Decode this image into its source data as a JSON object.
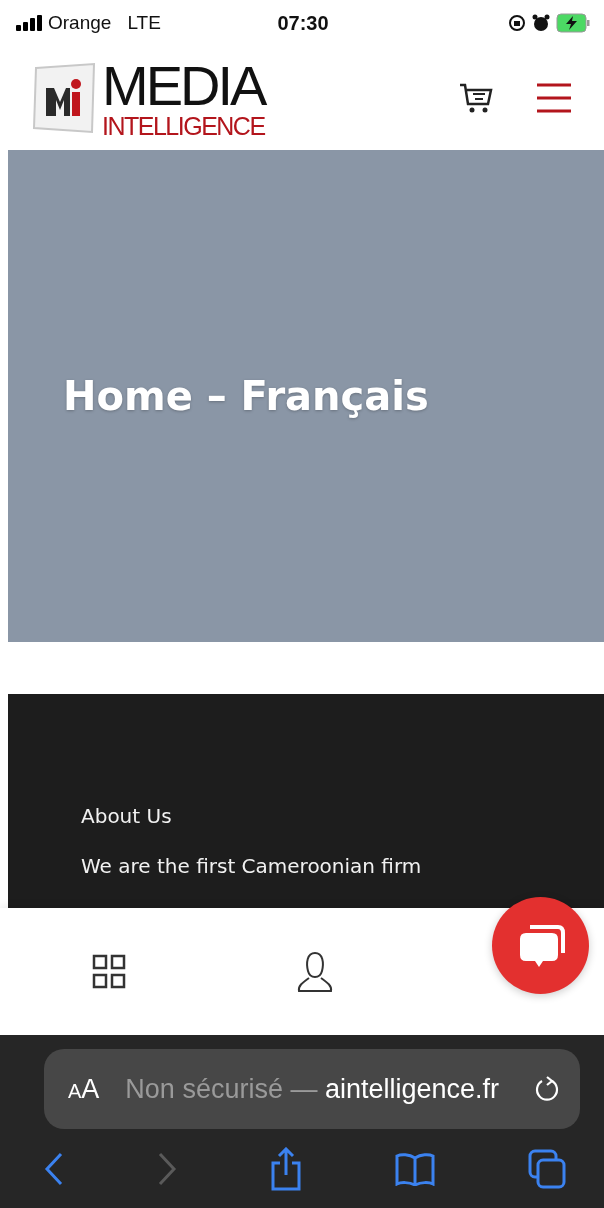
{
  "status_bar": {
    "carrier": "Orange",
    "network": "LTE",
    "time": "07:30",
    "battery_charging": true
  },
  "header": {
    "logo_top": "MEDIA",
    "logo_bottom": "INTELLIGENCE"
  },
  "hero": {
    "title": "Home – Français"
  },
  "footer": {
    "heading": "About Us",
    "text": "We are the first Cameroonian firm"
  },
  "browser": {
    "text_size": "AA",
    "url_prefix": "Non sécurisé — ",
    "url_host": "aintelligence.fr",
    "back_disabled": false,
    "forward_disabled": true
  }
}
